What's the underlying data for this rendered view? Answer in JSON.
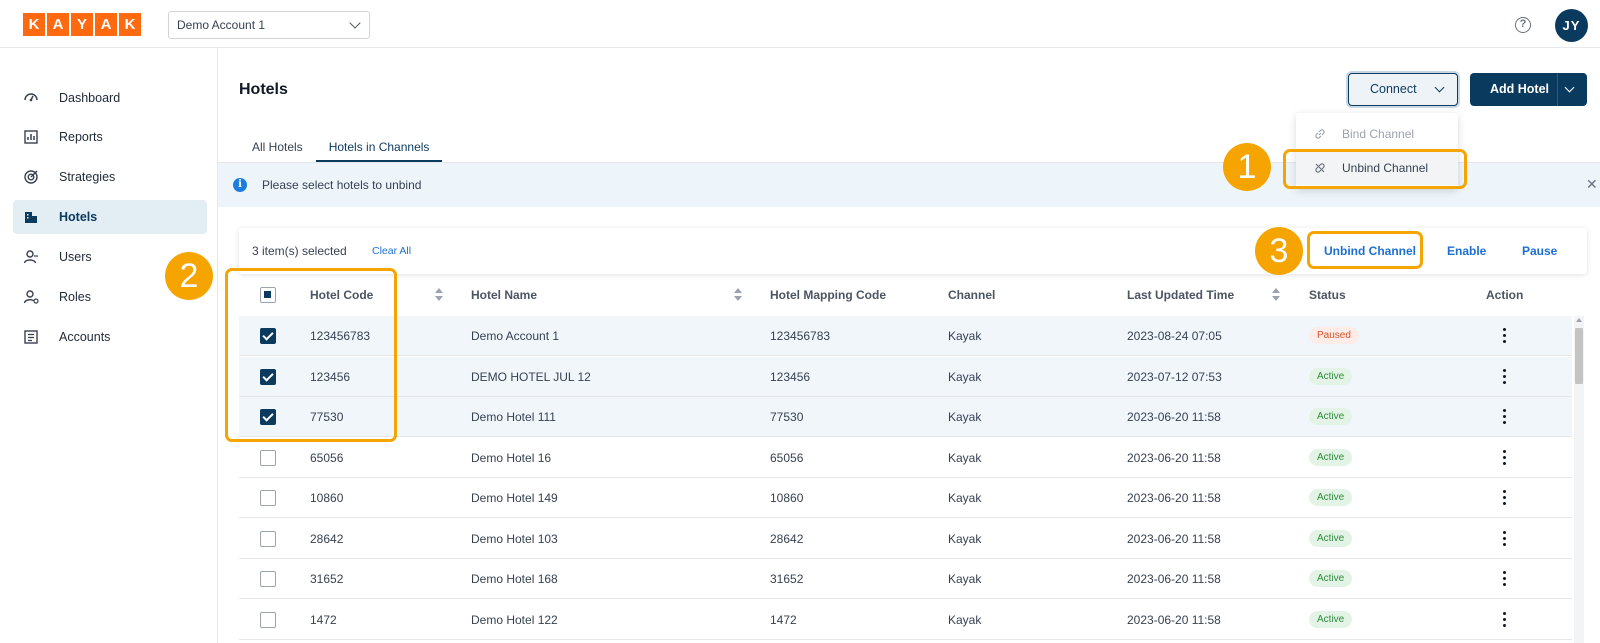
{
  "brand": {
    "logo_letters": [
      "K",
      "A",
      "Y",
      "A",
      "K"
    ],
    "accent": "#ff690f",
    "primary": "#0b3a5f"
  },
  "header": {
    "account_select": "Demo Account 1",
    "help_icon": "?",
    "avatar_initials": "JY"
  },
  "sidebar": {
    "items": [
      {
        "label": "Dashboard",
        "icon": "dashboard-icon"
      },
      {
        "label": "Reports",
        "icon": "reports-icon"
      },
      {
        "label": "Strategies",
        "icon": "strategies-icon"
      },
      {
        "label": "Hotels",
        "icon": "hotels-icon",
        "active": true
      },
      {
        "label": "Users",
        "icon": "users-icon"
      },
      {
        "label": "Roles",
        "icon": "roles-icon"
      },
      {
        "label": "Accounts",
        "icon": "accounts-icon"
      }
    ]
  },
  "page": {
    "title": "Hotels",
    "connect_label": "Connect",
    "add_hotel_label": "Add Hotel",
    "connect_menu": [
      {
        "label": "Bind Channel",
        "disabled": true
      },
      {
        "label": "Unbind Channel",
        "disabled": false
      }
    ],
    "tabs": [
      {
        "label": "All Hotels",
        "active": false
      },
      {
        "label": "Hotels in Channels",
        "active": true
      }
    ],
    "info_message": "Please select hotels to unbind",
    "selection": {
      "count_text": "3 item(s) selected",
      "clear_all": "Clear All",
      "actions": [
        "Unbind Channel",
        "Enable",
        "Pause"
      ]
    }
  },
  "table": {
    "columns": [
      "Hotel Code",
      "Hotel Name",
      "Hotel Mapping Code",
      "Channel",
      "Last Updated Time",
      "Status",
      "Action"
    ],
    "rows": [
      {
        "checked": true,
        "code": "123456783",
        "name": "Demo Account 1",
        "mapping": "123456783",
        "channel": "Kayak",
        "updated": "2023-08-24 07:05",
        "status": "Paused"
      },
      {
        "checked": true,
        "code": "123456",
        "name": "DEMO HOTEL JUL 12",
        "mapping": "123456",
        "channel": "Kayak",
        "updated": "2023-07-12 07:53",
        "status": "Active"
      },
      {
        "checked": true,
        "code": "77530",
        "name": "Demo Hotel 111",
        "mapping": "77530",
        "channel": "Kayak",
        "updated": "2023-06-20 11:58",
        "status": "Active"
      },
      {
        "checked": false,
        "code": "65056",
        "name": "Demo Hotel 16",
        "mapping": "65056",
        "channel": "Kayak",
        "updated": "2023-06-20 11:58",
        "status": "Active"
      },
      {
        "checked": false,
        "code": "10860",
        "name": "Demo Hotel 149",
        "mapping": "10860",
        "channel": "Kayak",
        "updated": "2023-06-20 11:58",
        "status": "Active"
      },
      {
        "checked": false,
        "code": "28642",
        "name": "Demo Hotel 103",
        "mapping": "28642",
        "channel": "Kayak",
        "updated": "2023-06-20 11:58",
        "status": "Active"
      },
      {
        "checked": false,
        "code": "31652",
        "name": "Demo Hotel 168",
        "mapping": "31652",
        "channel": "Kayak",
        "updated": "2023-06-20 11:58",
        "status": "Active"
      },
      {
        "checked": false,
        "code": "1472",
        "name": "Demo Hotel 122",
        "mapping": "1472",
        "channel": "Kayak",
        "updated": "2023-06-20 11:58",
        "status": "Active"
      }
    ]
  },
  "annotations": {
    "step1": "1",
    "step2": "2",
    "step3": "3",
    "color": "#f5a400"
  }
}
